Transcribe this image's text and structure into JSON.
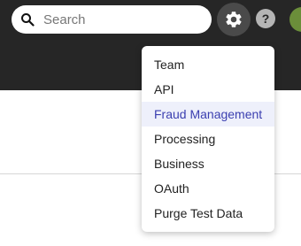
{
  "search": {
    "placeholder": "Search",
    "icon": "search-icon"
  },
  "header": {
    "settings_icon": "gear-icon",
    "help_label": "?",
    "avatar_initial": ""
  },
  "settings_menu": {
    "items": [
      {
        "label": "Team"
      },
      {
        "label": "API"
      },
      {
        "label": "Fraud Management",
        "active": true
      },
      {
        "label": "Processing"
      },
      {
        "label": "Business"
      },
      {
        "label": "OAuth"
      },
      {
        "label": "Purge Test Data"
      }
    ],
    "active_color": "#3b3fb0",
    "active_background": "#eef0fb"
  },
  "colors": {
    "topbar": "#262626",
    "avatar": "#6b8e3a"
  }
}
